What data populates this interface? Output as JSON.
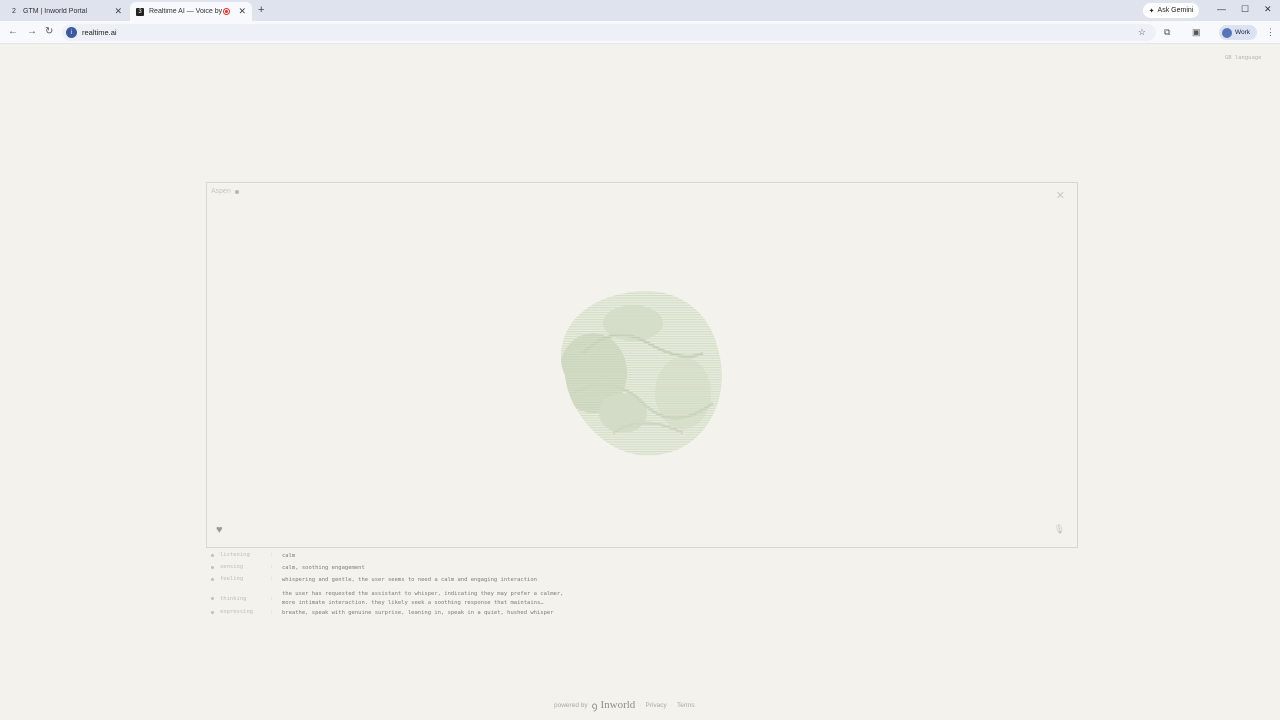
{
  "browser": {
    "tabs": [
      {
        "title": "GTM | Inworld Portal",
        "favicon": "2"
      },
      {
        "title": "Realtime AI — Voice by Inw",
        "favicon": "3"
      }
    ],
    "new_tab": "+",
    "ask_gemini": "Ask Gemini",
    "url": "realtime.ai",
    "profile": "Work"
  },
  "page": {
    "language": "GB language",
    "agent_name": "Aspen",
    "states": [
      {
        "label": "listening",
        "value": "calm"
      },
      {
        "label": "sensing",
        "value": "calm, soothing engagement"
      },
      {
        "label": "feeling",
        "value": "whispering and gentle, the user seems to need a calm and engaging interaction"
      },
      {
        "label": "thinking",
        "value": "the user has requested the assistant to whisper, indicating they may prefer a calmer,",
        "value2": "more intimate interaction. they likely seek a soothing response that maintains…"
      },
      {
        "label": "expressing",
        "value": "breathe, speak with genuine surprise, leaning in, speak in a quiet, hushed whisper"
      }
    ],
    "footer": {
      "powered_by": "powered by",
      "brand": "Inworld",
      "privacy": "Privacy",
      "terms": "Terms"
    }
  },
  "colors": {
    "background": "#f3f2ec",
    "orb": "#dfe8d4"
  }
}
